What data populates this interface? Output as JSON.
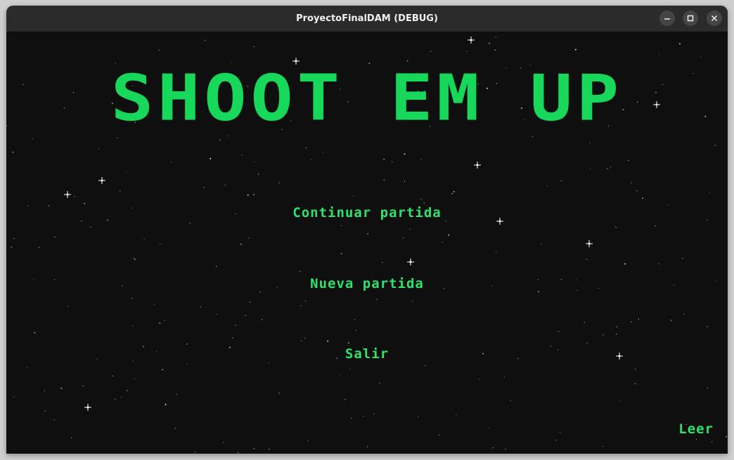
{
  "window": {
    "title": "ProyectoFinalDAM (DEBUG)",
    "controls": {
      "minimize": "minimize-icon",
      "maximize": "maximize-icon",
      "close": "close-icon"
    }
  },
  "game": {
    "title": "SHOOT EM UP",
    "menu": {
      "continue": "Continuar partida",
      "new_game": "Nueva partida",
      "exit": "Salir"
    },
    "read": "Leer"
  },
  "colors": {
    "accent": "#17d85a",
    "background": "#0f0f0f",
    "titlebar": "#2b2b2b"
  }
}
